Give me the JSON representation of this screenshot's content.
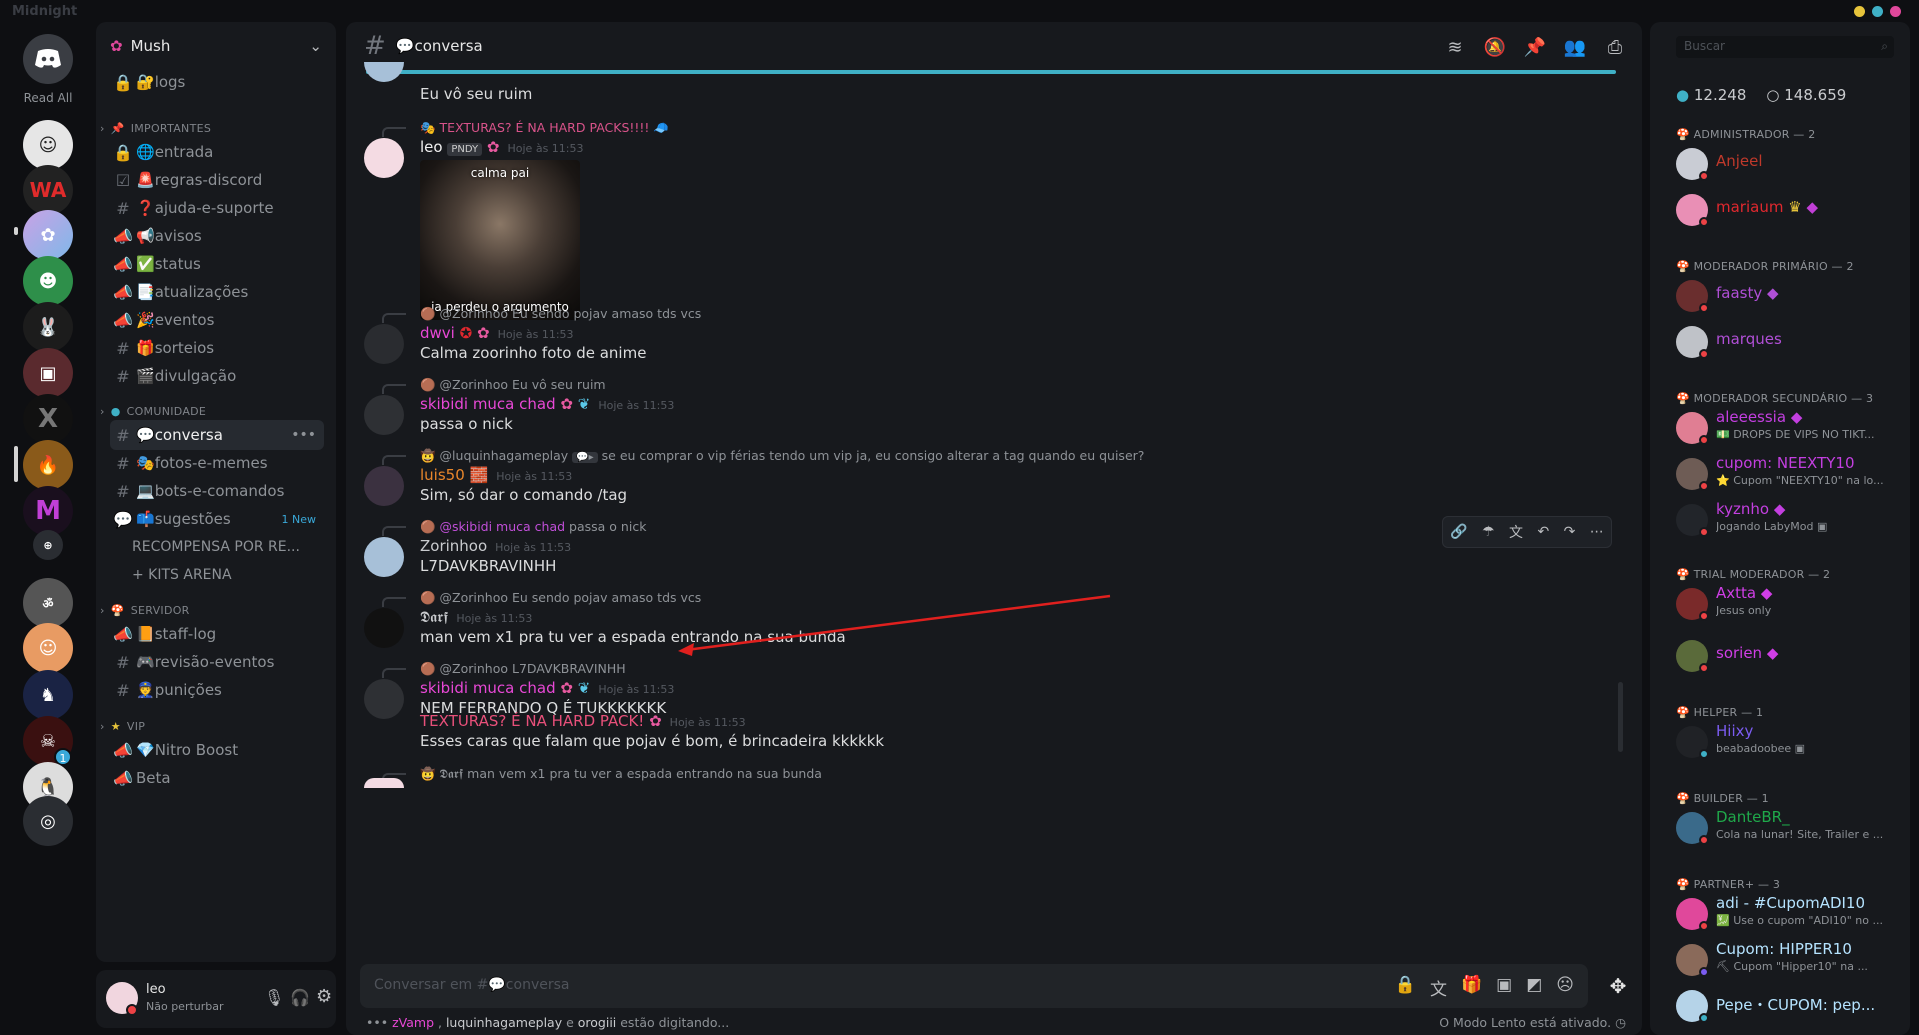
{
  "app": {
    "title": "Midnight"
  },
  "window_controls": {
    "c1": "#e7c43b",
    "c2": "#3fb0c6",
    "c3": "#e0489b"
  },
  "rail": {
    "read_all": "Read All",
    "badge_count": "1"
  },
  "sidebar": {
    "guild_name": "Mush",
    "channels_top": [
      {
        "label": "logs",
        "emoji": "🔐"
      }
    ],
    "cat_importantes": "IMPORTANTES",
    "importantes": [
      {
        "label": "entrada",
        "emoji": "🌐"
      },
      {
        "label": "regras-discord",
        "emoji": "🚨"
      },
      {
        "label": "ajuda-e-suporte",
        "emoji": "❓"
      },
      {
        "label": "avisos",
        "emoji": "📢"
      },
      {
        "label": "status",
        "emoji": "✅"
      },
      {
        "label": "atualizações",
        "emoji": "📑"
      },
      {
        "label": "eventos",
        "emoji": "🎉"
      },
      {
        "label": "sorteios",
        "emoji": "🎁"
      },
      {
        "label": "divulgação",
        "emoji": "🎬"
      }
    ],
    "cat_comunidade": "COMUNIDADE",
    "comunidade": [
      {
        "label": "conversa",
        "emoji": "💬"
      },
      {
        "label": "fotos-e-memes",
        "emoji": "🎭"
      },
      {
        "label": "bots-e-comandos",
        "emoji": "💻"
      },
      {
        "label": "sugestões",
        "emoji": "📫"
      }
    ],
    "new_badge": "1 New",
    "threads": [
      "RECOMPENSA POR RE...",
      "+ KITS ARENA"
    ],
    "cat_servidor": "SERVIDOR",
    "servidor": [
      {
        "label": "staff-log",
        "emoji": "📙"
      },
      {
        "label": "revisão-eventos",
        "emoji": "🎮"
      },
      {
        "label": "punições",
        "emoji": "👮"
      }
    ],
    "cat_vip": "VIP",
    "vip": [
      {
        "label": "Nitro Boost",
        "emoji": "💎"
      },
      {
        "label": "Beta",
        "emoji": ""
      }
    ]
  },
  "user_panel": {
    "name": "leo",
    "status": "Não perturbar"
  },
  "chat": {
    "channel": "conversa",
    "first_line": "Eu vô seu ruim",
    "messages": [
      {
        "reply": "TEXTURAS? É NA HARD PACKS!!!! 🧢",
        "user": "leo",
        "tag": "PNDY",
        "time": "Hoje às 11:53",
        "img_top": "calma pai",
        "img_bottom": "ja perdeu o argumento"
      },
      {
        "reply": "@Zorinhoo Eu sendo pojav amaso tds vcs",
        "user": "dwvi",
        "time": "Hoje às 11:53",
        "text": "Calma zoorinho foto de anime"
      },
      {
        "reply": "@Zorinhoo Eu vô seu ruim",
        "user": "skibidi muca chad",
        "time": "Hoje às 11:53",
        "text": "passa o nick"
      },
      {
        "reply": "@luquinhagameplay",
        "reply_text": "se eu comprar o vip férias tendo um vip ja, eu consigo alterar a tag quando eu quiser?",
        "user": "luis50",
        "time": "Hoje às 11:53",
        "text": "Sim, só dar o comando /tag"
      },
      {
        "reply": "@skibidi muca chad",
        "reply_text": "passa o nick",
        "user": "Zorinhoo",
        "time": "Hoje às 11:53",
        "text": "L7DAVKBRAVINHH"
      },
      {
        "reply": "@Zorinhoo Eu sendo pojav amaso tds vcs",
        "user": "𝕯𝖆𝖗𝖋",
        "time": "Hoje às 11:53",
        "text": "man vem x1 pra tu ver a espada entrando na sua bunda"
      },
      {
        "reply": "@Zorinhoo L7DAVKBRAVINHH",
        "user": "skibidi muca chad",
        "time": "Hoje às 11:53",
        "text": "NEM FERRANDO Q É TUKKKKKKK"
      },
      {
        "user": "TEXTURAS? É NA HARD PACK!",
        "time": "Hoje às 11:53",
        "text": "Esses caras que falam que pojav é bom, é brincadeira kkkkkk"
      },
      {
        "reply": "𝕯𝖆𝖗𝖋 man vem x1 pra tu ver a espada entrando na sua bunda"
      }
    ],
    "input_placeholder": "Conversar em #💬conversa",
    "typing": "zVamp , luquinhagameplay e orogiii estão digitando...",
    "typing_u1": "zVamp",
    "typing_u2": "luquinhagameplay",
    "typing_u3": "orogiii",
    "typing_mid": " , ",
    " e ": " e ",
    "typing_end": " estão digitando...",
    "slowmode": "O Modo Lento está ativado."
  },
  "members": {
    "search_placeholder": "Buscar",
    "online": "12.248",
    "total": "148.659",
    "groups": [
      {
        "role": "ADMINISTRADOR — 2",
        "members": [
          {
            "name": "Anjeel",
            "color": "#c0392b"
          },
          {
            "name": "mariaum",
            "color": "#e0282e",
            "status": ""
          }
        ]
      },
      {
        "role": "MODERADOR PRIMÁRIO — 2",
        "members": [
          {
            "name": "faasty",
            "color": "#b04fd6"
          },
          {
            "name": "marques",
            "color": "#b04fd6"
          }
        ]
      },
      {
        "role": "MODERADOR SECUNDÁRIO — 3",
        "members": [
          {
            "name": "aleeessia",
            "color": "#c33fe0",
            "status": "💵 DROPS DE VIPS NO TIKT..."
          },
          {
            "name": "cupom: NEEXTY10",
            "color": "#c33fe0",
            "status": "⭐ Cupom \"NEEXTY10\" na lo..."
          },
          {
            "name": "kyznho",
            "color": "#c33fe0",
            "status": "Jogando LabyMod"
          }
        ]
      },
      {
        "role": "TRIAL MODERADOR — 2",
        "members": [
          {
            "name": "Axtta",
            "color": "#d03ee6",
            "status": "Jesus only"
          },
          {
            "name": "sorien",
            "color": "#d03ee6"
          }
        ]
      },
      {
        "role": "HELPER — 1",
        "members": [
          {
            "name": "Hiixy",
            "color": "#7b5cf0",
            "status": "beabadoobee"
          }
        ]
      },
      {
        "role": "BUILDER — 1",
        "members": [
          {
            "name": "DanteBR_",
            "color": "#1fa84a",
            "status": "Cola na lunar! Site, Trailer e ..."
          }
        ]
      },
      {
        "role": "PARTNER+ — 3",
        "members": [
          {
            "name": "adi - #CupomADI10",
            "color": "#b5e3ff",
            "status": "💹 Use o cupom \"ADI10\" no ..."
          },
          {
            "name": "Cupom: HIPPER10",
            "color": "#b5e3ff",
            "status": "⛏ Cupom \"Hipper10\" na ..."
          },
          {
            "name": "Pepe・CUPOM: pep...",
            "color": "#b5e3ff"
          }
        ]
      }
    ]
  }
}
